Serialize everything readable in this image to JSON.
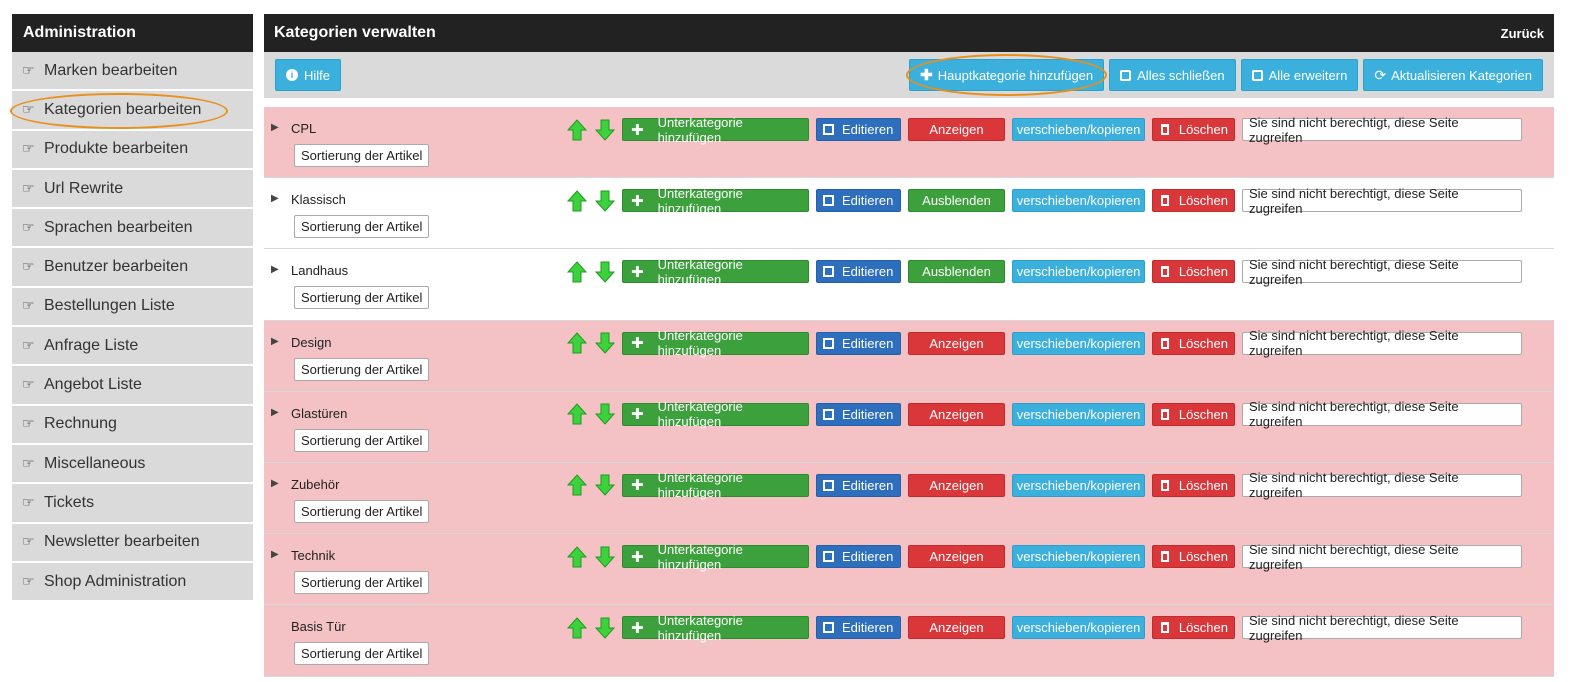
{
  "sidebar": {
    "title": "Administration",
    "items": [
      {
        "label": "Marken bearbeiten",
        "active": false
      },
      {
        "label": "Kategorien bearbeiten",
        "active": true
      },
      {
        "label": "Produkte bearbeiten",
        "active": false
      },
      {
        "label": "Url Rewrite",
        "active": false
      },
      {
        "label": "Sprachen bearbeiten",
        "active": false
      },
      {
        "label": "Benutzer bearbeiten",
        "active": false
      },
      {
        "label": "Bestellungen Liste",
        "active": false
      },
      {
        "label": "Anfrage Liste",
        "active": false
      },
      {
        "label": "Angebot Liste",
        "active": false
      },
      {
        "label": "Rechnung",
        "active": false
      },
      {
        "label": "Miscellaneous",
        "active": false
      },
      {
        "label": "Tickets",
        "active": false
      },
      {
        "label": "Newsletter bearbeiten",
        "active": false
      },
      {
        "label": "Shop Administration",
        "active": false
      }
    ]
  },
  "header": {
    "title": "Kategorien verwalten",
    "back": "Zurück"
  },
  "toolbar": {
    "help": "Hilfe",
    "add_main": "Hauptkategorie hinzufügen",
    "collapse_all": "Alles schließen",
    "expand_all": "Alle erweitern",
    "refresh": "Aktualisieren Kategorien"
  },
  "row_labels": {
    "sort": "Sortierung der Artikel",
    "add_sub": "Unterkategorie hinzufügen",
    "edit": "Editieren",
    "move": "verschieben/kopieren",
    "delete": "Löschen",
    "no_permission": "Sie sind nicht berechtigt, diese Seite zugreifen"
  },
  "categories": [
    {
      "name": "CPL",
      "toggle": "Anzeigen",
      "visible": false,
      "expandable": true
    },
    {
      "name": "Klassisch",
      "toggle": "Ausblenden",
      "visible": true,
      "expandable": true
    },
    {
      "name": "Landhaus",
      "toggle": "Ausblenden",
      "visible": true,
      "expandable": true
    },
    {
      "name": "Design",
      "toggle": "Anzeigen",
      "visible": false,
      "expandable": true
    },
    {
      "name": "Glastüren",
      "toggle": "Anzeigen",
      "visible": false,
      "expandable": true
    },
    {
      "name": "Zubehör",
      "toggle": "Anzeigen",
      "visible": false,
      "expandable": true
    },
    {
      "name": "Technik",
      "toggle": "Anzeigen",
      "visible": false,
      "expandable": true
    },
    {
      "name": "Basis Tür",
      "toggle": "Anzeigen",
      "visible": false,
      "expandable": false
    }
  ],
  "colors": {
    "hidden_row": "#f4c2c4",
    "visible_row": "#ffffff",
    "highlight": "#e8901b",
    "header": "#222222"
  }
}
